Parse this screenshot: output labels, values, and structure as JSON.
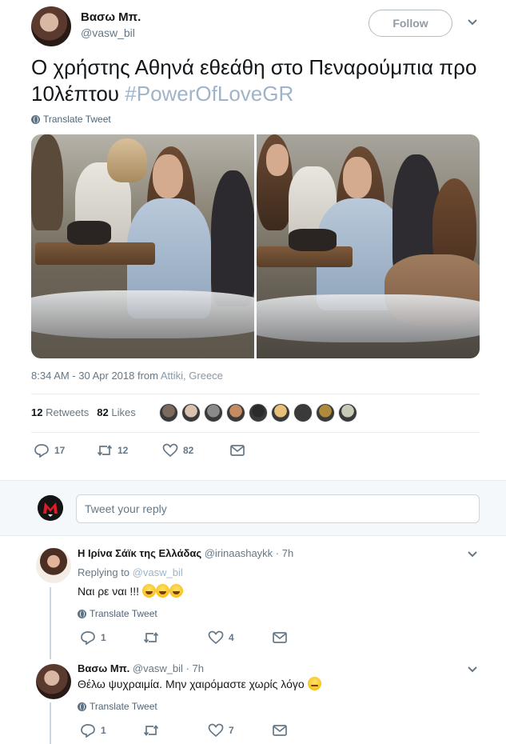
{
  "tweet": {
    "author_name": "Βασω Μπ.",
    "author_handle": "@vasw_bil",
    "follow_label": "Follow",
    "text_main": "Ο χρήστης Αθηνά εθεάθη στο Πεναρούμπια προ 10λέπτου",
    "hashtag": "#PowerOfLoveGR",
    "translate_label": "Translate Tweet",
    "timestamp": "8:34 AM - 30 Apr 2018 from",
    "location": "Attiki, Greece",
    "retweets_count": "12",
    "retweets_label": "Retweets",
    "likes_count": "82",
    "likes_label": "Likes",
    "liker_avatars": [
      "#7c6a5e",
      "#d9c2b0",
      "#8a8a8a",
      "#c58b62",
      "#2b2b2b",
      "#e8c07a",
      "#3a3a3a",
      "#b08a3c",
      "#c9c9b8"
    ],
    "actions": {
      "reply_count": "17",
      "retweet_count": "12",
      "like_count": "82"
    }
  },
  "reply_composer": {
    "placeholder": "Tweet your reply"
  },
  "replies": [
    {
      "name": "Η Ιρίνα Σάϊκ της Ελλάδας",
      "handle": "@irinaashaykk",
      "time": "· 7h",
      "replying_label": "Replying to",
      "replying_to": "@vasw_bil",
      "text": "Ναι ρε ναι !!!",
      "translate_label": "Translate Tweet",
      "reply_count": "1",
      "retweet_count": "",
      "like_count": "4"
    },
    {
      "name": "Βασω Μπ.",
      "handle": "@vasw_bil",
      "time": "· 7h",
      "text": "Θέλω ψυχραιμία. Μην χαιρόμαστε χωρίς λόγο",
      "translate_label": "Translate Tweet",
      "reply_count": "1",
      "retweet_count": "",
      "like_count": "7"
    }
  ],
  "colors": {
    "link": "#9fb4c8",
    "secondary": "#657786",
    "border": "#e6ecf0"
  },
  "icons": [
    "caret-down-icon",
    "globe-icon",
    "reply-icon",
    "retweet-icon",
    "like-icon",
    "message-icon"
  ]
}
